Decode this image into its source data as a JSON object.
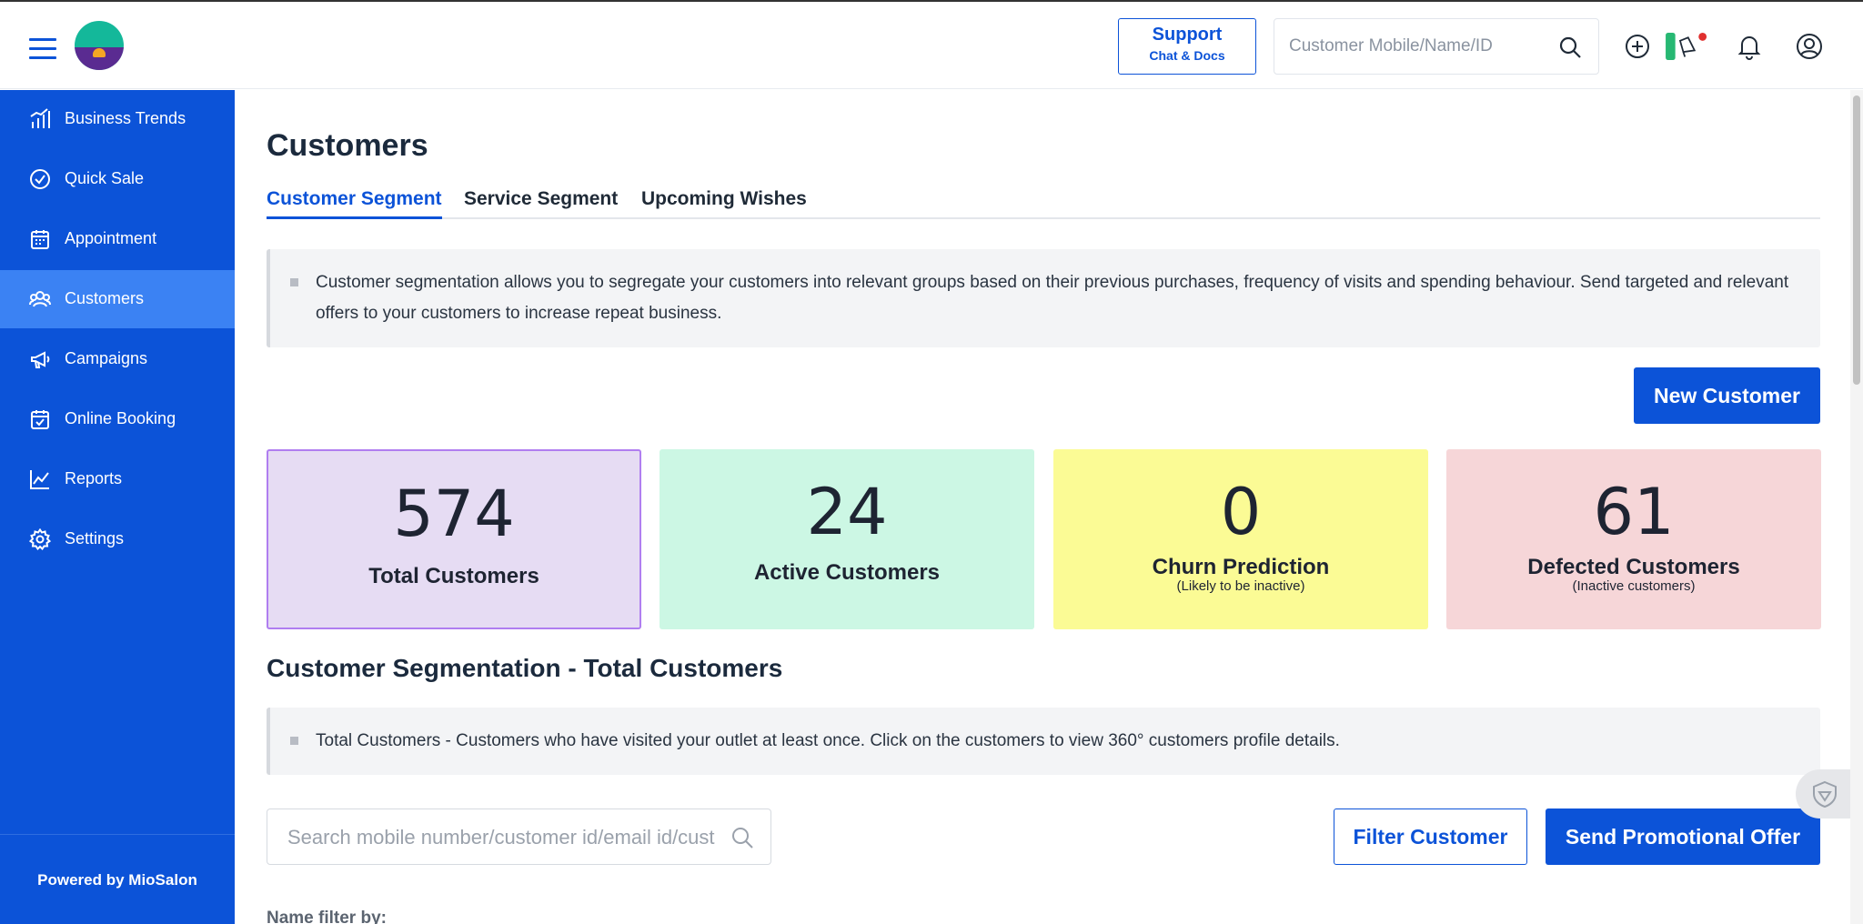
{
  "header": {
    "support_title": "Support",
    "support_subtitle": "Chat & Docs",
    "search_placeholder": "Customer Mobile/Name/ID"
  },
  "sidebar": {
    "items": [
      {
        "label": "Business Trends",
        "icon": "bar-chart-icon"
      },
      {
        "label": "Quick Sale",
        "icon": "check-circle-icon"
      },
      {
        "label": "Appointment",
        "icon": "calendar-icon"
      },
      {
        "label": "Customers",
        "icon": "users-icon",
        "active": true
      },
      {
        "label": "Campaigns",
        "icon": "megaphone-icon"
      },
      {
        "label": "Online Booking",
        "icon": "calendar-check-icon"
      },
      {
        "label": "Reports",
        "icon": "line-chart-icon"
      },
      {
        "label": "Settings",
        "icon": "gear-icon"
      }
    ],
    "powered_by": "Powered by MioSalon"
  },
  "main": {
    "title": "Customers",
    "tabs": [
      {
        "label": "Customer Segment",
        "active": true
      },
      {
        "label": "Service Segment"
      },
      {
        "label": "Upcoming Wishes"
      }
    ],
    "intro_text": "Customer segmentation allows you to segregate your customers into relevant groups based on their previous purchases, frequency of visits and spending behaviour. Send targeted and relevant offers to your customers to increase repeat business.",
    "new_customer_label": "New Customer",
    "cards": [
      {
        "value": "574",
        "label": "Total Customers",
        "sublabel": "",
        "color": "#e6dcf3",
        "border": "#b07ef0"
      },
      {
        "value": "24",
        "label": "Active Customers",
        "sublabel": "",
        "color": "#ccf7e4",
        "border": "#ccf7e4"
      },
      {
        "value": "0",
        "label": "Churn Prediction",
        "sublabel": "(Likely to be inactive)",
        "color": "#fbfb95",
        "border": "#fbfb95"
      },
      {
        "value": "61",
        "label": "Defected Customers",
        "sublabel": "(Inactive customers)",
        "color": "#f6d6d8",
        "border": "#f6d6d8"
      }
    ],
    "section_title": "Customer Segmentation - Total Customers",
    "section_text": "Total Customers - Customers who have visited your outlet at least once. Click on the customers to view 360° customers profile details.",
    "search_placeholder": "Search mobile number/customer id/email id/customer name",
    "filter_label": "Filter Customer",
    "promo_label": "Send Promotional Offer",
    "name_filter_label": "Name filter by:"
  },
  "colors": {
    "primary": "#0c53d8",
    "sidebar_active": "#3b82f3"
  }
}
